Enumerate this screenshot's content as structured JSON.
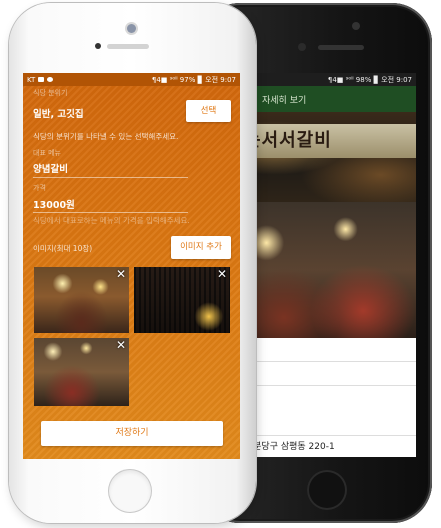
{
  "back_screen": {
    "status_text": "¶4■ ⁹⁰ˡˡ 98% ▊ 오전 9:07",
    "appbar_title": "자세히 보기",
    "sign_text": "는서서갈비",
    "address": "시 분당구 삼평동 220-1"
  },
  "front_screen": {
    "status": {
      "carrier": "KT",
      "right_text": "¶4■ ⁹⁰ˡˡ 97% ▊ 오전 9:07"
    },
    "category": {
      "label": "식당 분위기",
      "value": "일반, 고깃집",
      "hint": "식당의 분위기를 나타낼 수 있는 선택해주세요.",
      "select_button": "선택"
    },
    "menu": {
      "label": "대표 메뉴",
      "value": "양념갈비"
    },
    "price": {
      "label": "가격",
      "value": "13000원",
      "hint": "식당에서 대표로하는 메뉴의 가격을 입력해주세요."
    },
    "images": {
      "label": "이미지(최대 10장)",
      "add_button": "이미지 추가",
      "remove_symbol": "✕"
    },
    "save_button": "저장하기"
  }
}
